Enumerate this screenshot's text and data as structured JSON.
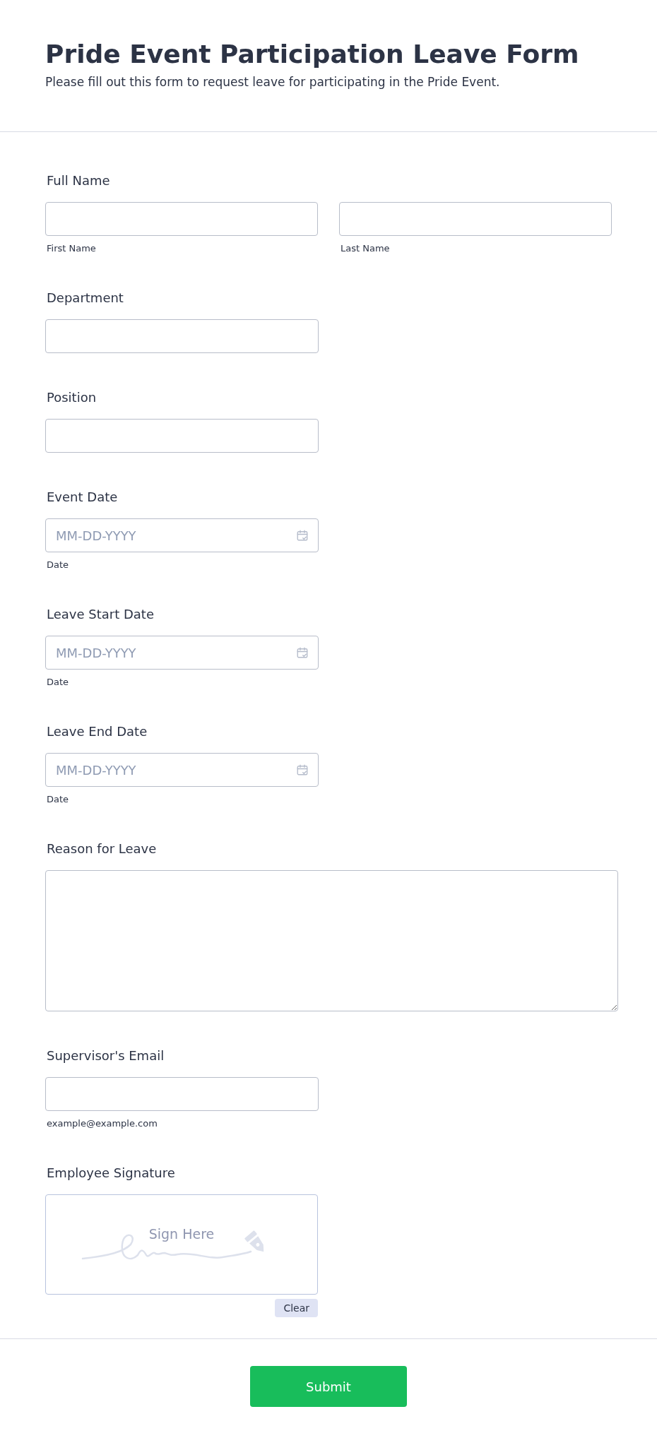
{
  "header": {
    "title": "Pride Event Participation Leave Form",
    "subtitle": "Please fill out this form to request leave for participating in the Pride Event."
  },
  "fields": [
    {
      "kind": "name",
      "label": "Full Name",
      "parts": [
        {
          "sublabel": "First Name"
        },
        {
          "sublabel": "Last Name"
        }
      ]
    },
    {
      "kind": "text",
      "label": "Department"
    },
    {
      "kind": "text",
      "label": "Position"
    },
    {
      "kind": "date",
      "label": "Event Date",
      "placeholder": "MM-DD-YYYY",
      "sublabel": "Date"
    },
    {
      "kind": "date",
      "label": "Leave Start Date",
      "placeholder": "MM-DD-YYYY",
      "sublabel": "Date"
    },
    {
      "kind": "date",
      "label": "Leave End Date",
      "placeholder": "MM-DD-YYYY",
      "sublabel": "Date"
    },
    {
      "kind": "textarea",
      "label": "Reason for Leave"
    },
    {
      "kind": "email",
      "label": "Supervisor's Email",
      "sublabel": "example@example.com"
    },
    {
      "kind": "signature",
      "label": "Employee Signature",
      "prompt": "Sign Here",
      "clear": "Clear"
    }
  ],
  "submit": "Submit"
}
